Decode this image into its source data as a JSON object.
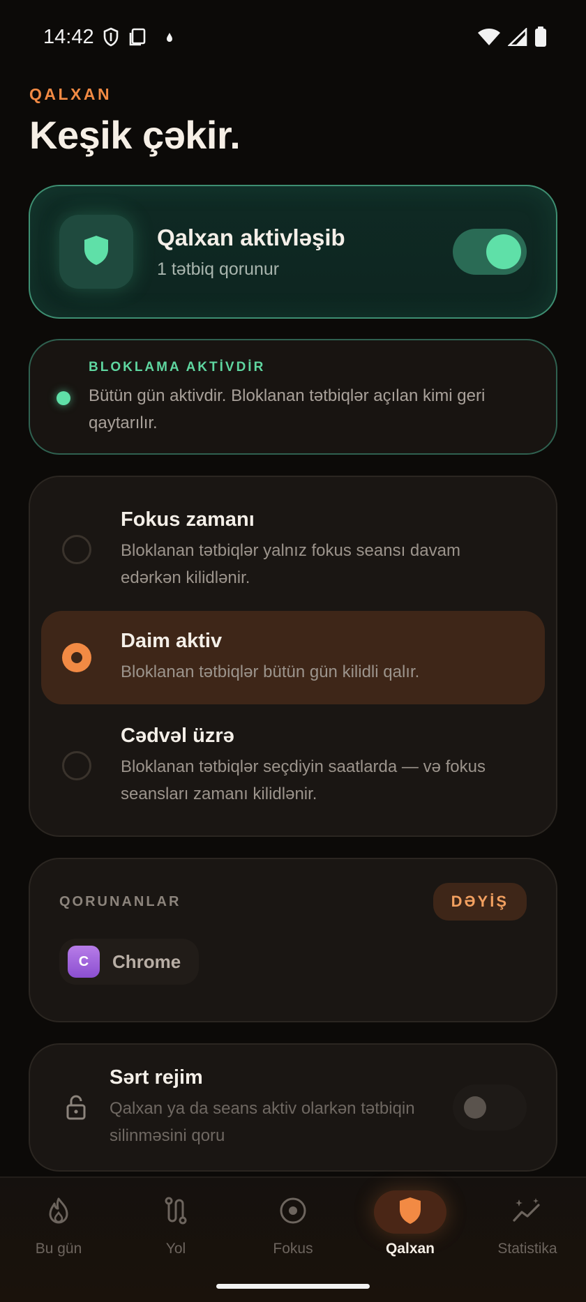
{
  "status_bar": {
    "time": "14:42"
  },
  "header": {
    "eyebrow": "QALXAN",
    "title": "Keşik çəkir."
  },
  "shield_card": {
    "title": "Qalxan aktivləşib",
    "subtitle": "1 tətbiq qorunur",
    "toggle_on": true
  },
  "blocking_status": {
    "label": "BLOKLAMA AKTİVDİR",
    "description": "Bütün gün aktivdir. Bloklanan tətbiqlər açılan kimi geri qaytarılır."
  },
  "modes": [
    {
      "title": "Fokus zamanı",
      "description": "Bloklanan tətbiqlər yalnız fokus seansı davam edərkən kilidlənir.",
      "selected": false
    },
    {
      "title": "Daim aktiv",
      "description": "Bloklanan tətbiqlər bütün gün kilidli qalır.",
      "selected": true
    },
    {
      "title": "Cədvəl üzrə",
      "description": "Bloklanan tətbiqlər seçdiyin saatlarda — və fokus seansları zamanı kilidlənir.",
      "selected": false
    }
  ],
  "protected": {
    "label": "QORUNANLAR",
    "change_label": "DƏYİŞ",
    "apps": [
      {
        "initial": "C",
        "name": "Chrome"
      }
    ]
  },
  "strict_mode": {
    "title": "Sərt rejim",
    "description": "Qalxan ya da seans aktiv olarkən tətbiqin silinməsini qoru",
    "toggle_on": false
  },
  "nav": [
    {
      "label": "Bu gün",
      "icon": "flame-icon",
      "active": false
    },
    {
      "label": "Yol",
      "icon": "route-icon",
      "active": false
    },
    {
      "label": "Fokus",
      "icon": "target-icon",
      "active": false
    },
    {
      "label": "Qalxan",
      "icon": "shield-icon",
      "active": true
    },
    {
      "label": "Statistika",
      "icon": "chart-sparkle-icon",
      "active": false
    }
  ],
  "colors": {
    "accent": "#f28a44",
    "success": "#5fe0a8",
    "background": "#0c0a08"
  }
}
